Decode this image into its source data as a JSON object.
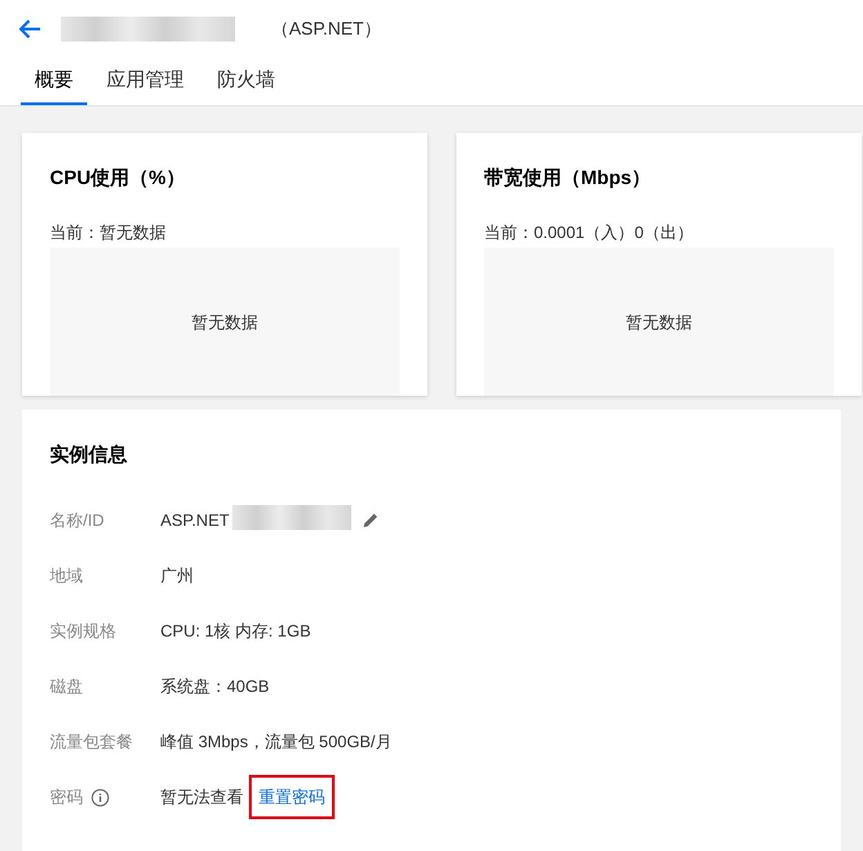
{
  "header": {
    "title": "（ASP.NET）"
  },
  "tabs": [
    {
      "label": "概要",
      "selected": true
    },
    {
      "label": "应用管理",
      "selected": false
    },
    {
      "label": "防火墙",
      "selected": false
    }
  ],
  "metrics": [
    {
      "title": "CPU使用（%）",
      "current": "当前：暂无数据",
      "empty": "暂无数据"
    },
    {
      "title": "带宽使用（Mbps）",
      "current": "当前：0.0001（入）0（出）",
      "empty": "暂无数据"
    }
  ],
  "instance": {
    "title": "实例信息",
    "rows": [
      {
        "kind": "editable",
        "label": "名称/ID",
        "value": "ASP.NET"
      },
      {
        "kind": "plain",
        "label": "地域",
        "value": "广州"
      },
      {
        "kind": "plain",
        "label": "实例规格",
        "value": "CPU: 1核 内存: 1GB"
      },
      {
        "kind": "plain",
        "label": "磁盘",
        "value": "系统盘：40GB"
      },
      {
        "kind": "plain",
        "label": "流量包套餐",
        "value": "峰值 3Mbps，流量包 500GB/月"
      },
      {
        "kind": "password",
        "label": "密码",
        "value": "暂无法查看",
        "link": "重置密码"
      }
    ]
  }
}
